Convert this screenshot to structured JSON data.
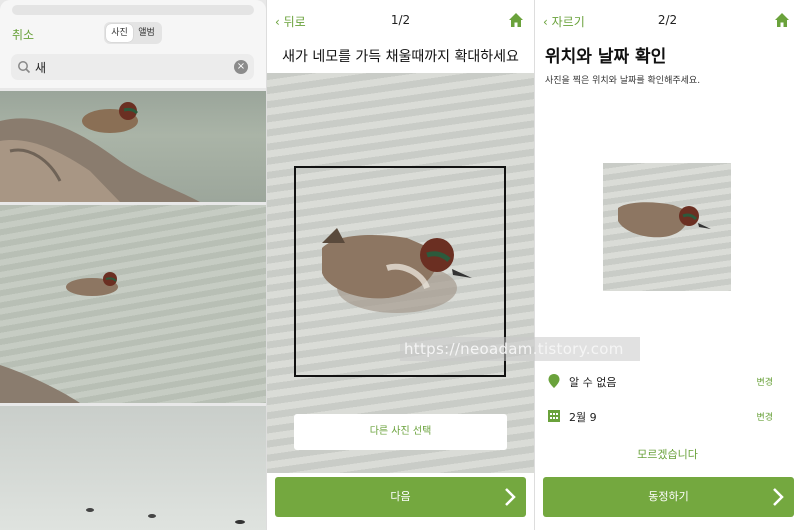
{
  "panel1": {
    "cancel_label": "취소",
    "segments": [
      "사진",
      "앨범"
    ],
    "search_value": "새"
  },
  "panel2": {
    "back_label": "뒤로",
    "step": "1/2",
    "title": "새가 네모를 가득 채울때까지 확대하세요",
    "alt_button_label": "다른 사진 선택",
    "next_label": "다음"
  },
  "panel3": {
    "back_label": "자르기",
    "step": "2/2",
    "title": "위치와 날짜 확인",
    "subtitle": "사진을 찍은 위치와 날짜를 확인해주세요.",
    "location_label": "알 수 없음",
    "date_label": "2월 9",
    "change_label": "변경",
    "unknown_label": "모르겠습니다",
    "submit_label": "동정하기"
  },
  "watermark": "https://neoadam.tistory.com",
  "colors": {
    "accent": "#74a83f",
    "link": "#6aa23b"
  }
}
